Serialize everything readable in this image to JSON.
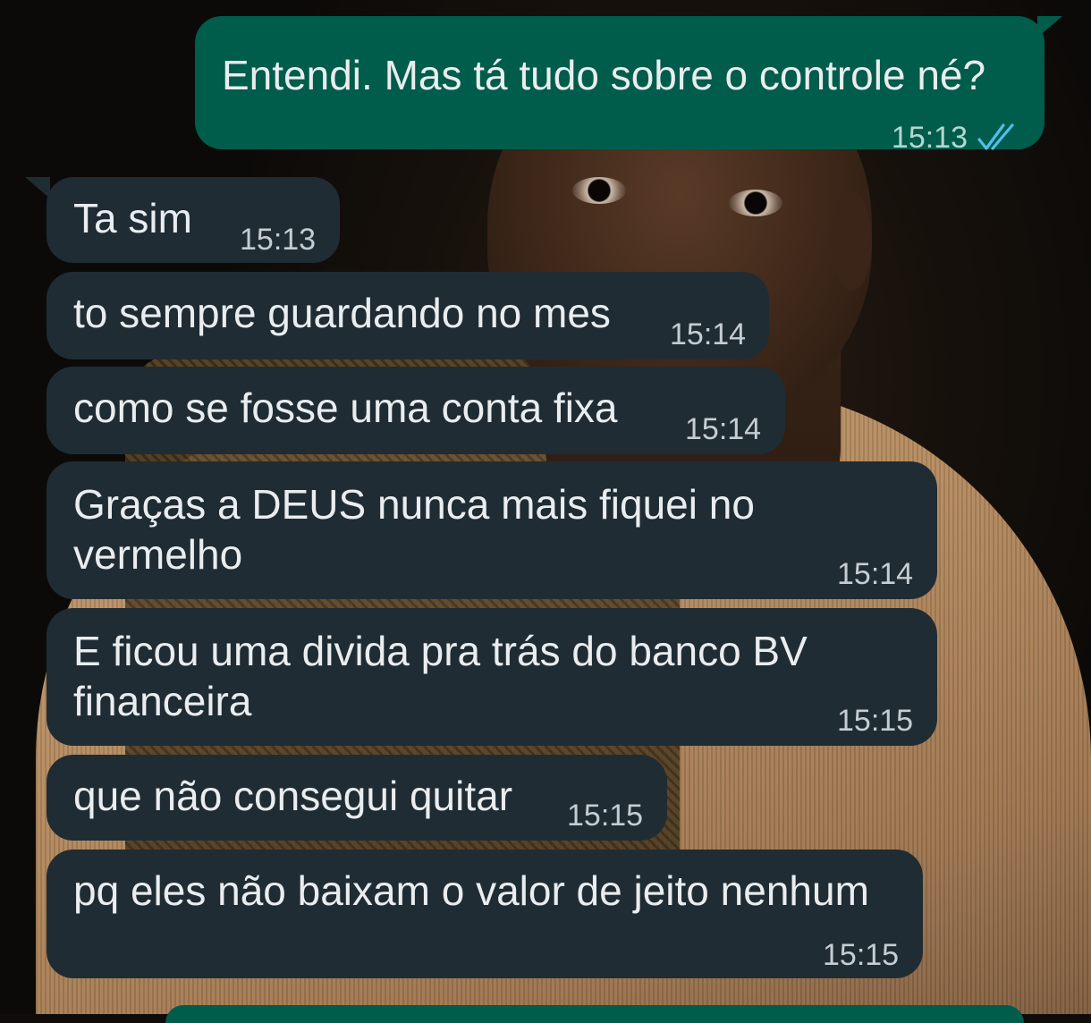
{
  "colors": {
    "incoming_bubble": "#202c33",
    "outgoing_bubble": "#005c4b",
    "text": "#e9edef",
    "read_ticks": "#53bdeb"
  },
  "messages": [
    {
      "direction": "outgoing",
      "text": "Entendi. Mas tá tudo sobre o controle né?",
      "time": "15:13",
      "status_icon": "double-check-read-icon"
    },
    {
      "direction": "incoming",
      "text": "Ta sim",
      "time": "15:13"
    },
    {
      "direction": "incoming",
      "text": "to sempre guardando no mes",
      "time": "15:14"
    },
    {
      "direction": "incoming",
      "text": "como se fosse uma conta fixa",
      "time": "15:14"
    },
    {
      "direction": "incoming",
      "text_lines": [
        "Graças a DEUS nunca mais fiquei no",
        "vermelho"
      ],
      "time": "15:14"
    },
    {
      "direction": "incoming",
      "text_lines": [
        "E ficou uma divida pra trás do banco BV",
        "financeira"
      ],
      "time": "15:15"
    },
    {
      "direction": "incoming",
      "text": "que não consegui quitar",
      "time": "15:15"
    },
    {
      "direction": "incoming",
      "text": "pq eles não baixam o valor de jeito nenhum",
      "time": "15:15"
    }
  ]
}
